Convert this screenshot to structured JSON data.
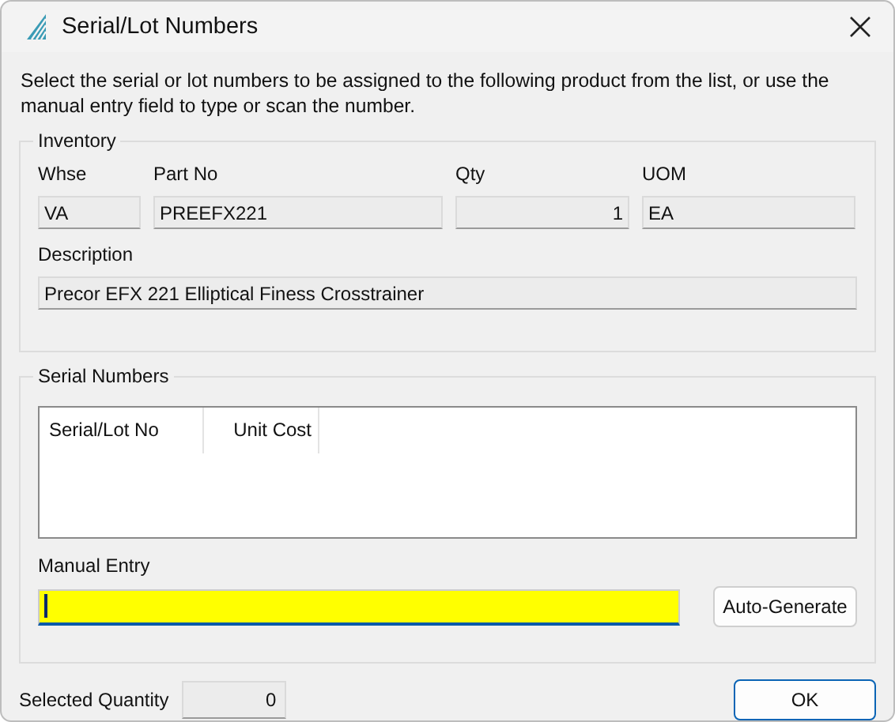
{
  "window": {
    "title": "Serial/Lot Numbers"
  },
  "instructions": "Select the serial or lot numbers to be assigned to the following product from the list, or use the manual entry field to type or scan the number.",
  "inventory": {
    "legend": "Inventory",
    "fields": [
      {
        "label": "Whse",
        "value": "VA",
        "kind": "text"
      },
      {
        "label": "Part No",
        "value": "PREEFX221",
        "kind": "text"
      },
      {
        "label": "Qty",
        "value": "1",
        "kind": "numeric"
      },
      {
        "label": "UOM",
        "value": "EA",
        "kind": "text"
      }
    ],
    "description": {
      "label": "Description",
      "value": "Precor EFX 221 Elliptical Finess Crosstrainer"
    }
  },
  "serial_numbers": {
    "legend": "Serial Numbers",
    "columns": [
      "Serial/Lot No",
      "Unit Cost"
    ],
    "manual_entry": {
      "label": "Manual Entry",
      "focused": true
    },
    "button": "Auto-Generate"
  },
  "selected_quantity": {
    "label": "Selected Quantity",
    "value": "0"
  },
  "buttons": [
    {
      "label": "OK",
      "default": true
    }
  ]
}
